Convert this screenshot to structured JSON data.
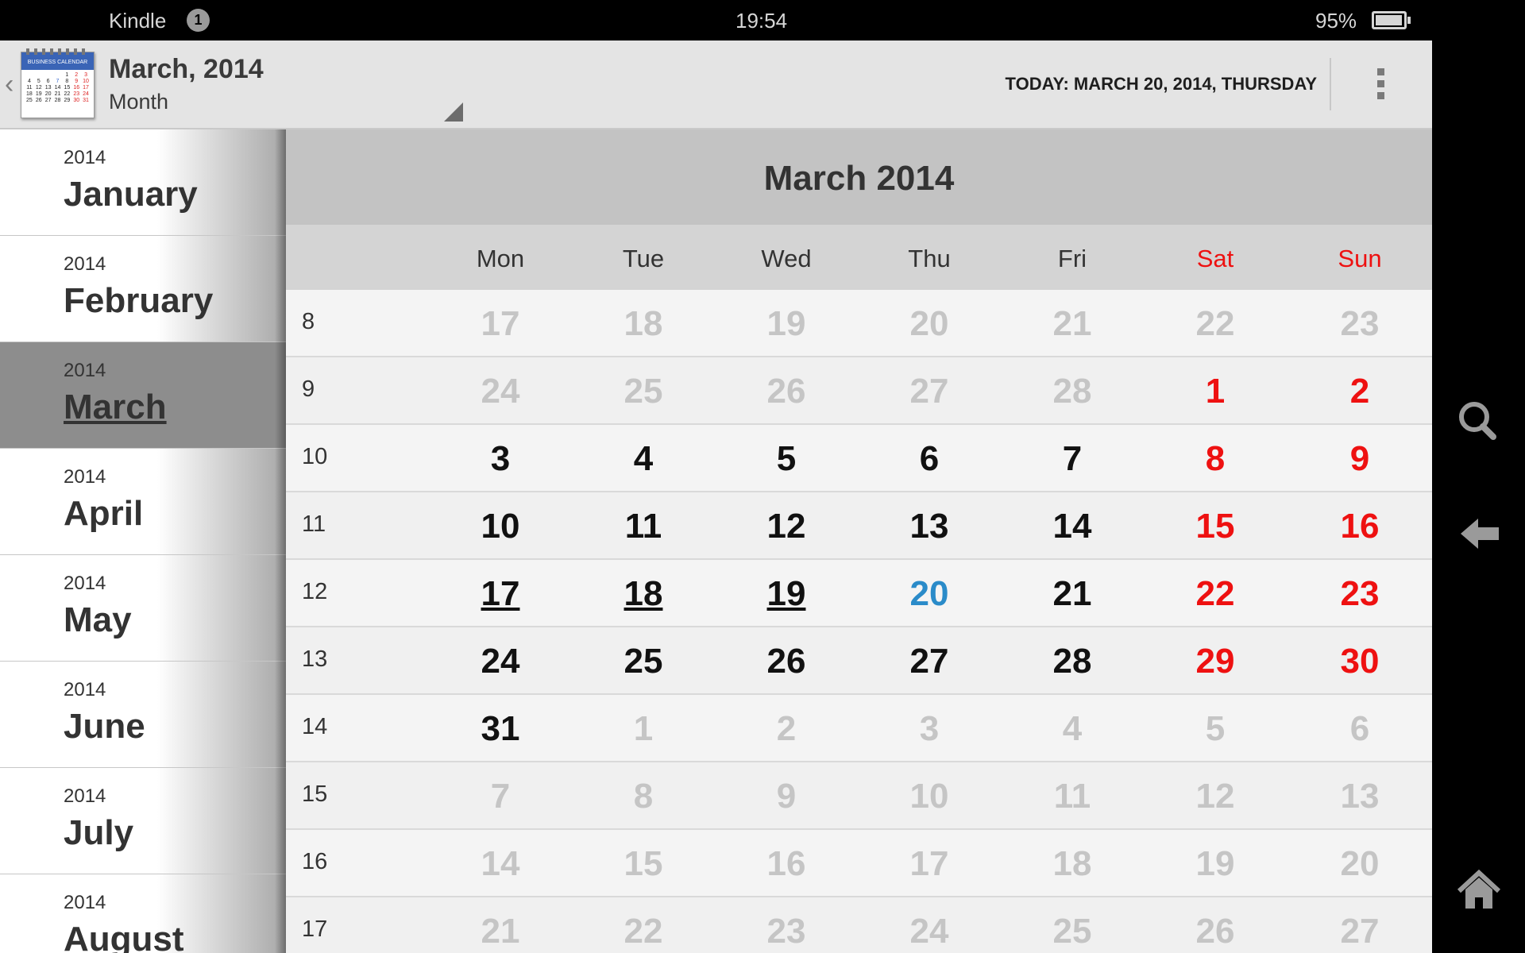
{
  "status_bar": {
    "app_name": "Kindle",
    "notification_count": "1",
    "time": "19:54",
    "battery": "95%"
  },
  "action_bar": {
    "title": "March, 2014",
    "view_mode": "Month",
    "today": "TODAY: MARCH 20, 2014, THURSDAY",
    "app_icon": "business-calendar-icon"
  },
  "sidebar": {
    "items": [
      {
        "year": "2014",
        "month": "January"
      },
      {
        "year": "2014",
        "month": "February"
      },
      {
        "year": "2014",
        "month": "March"
      },
      {
        "year": "2014",
        "month": "April"
      },
      {
        "year": "2014",
        "month": "May"
      },
      {
        "year": "2014",
        "month": "June"
      },
      {
        "year": "2014",
        "month": "July"
      },
      {
        "year": "2014",
        "month": "August"
      }
    ],
    "selected": "March"
  },
  "calendar": {
    "title": "March 2014",
    "weekdays": [
      "Mon",
      "Tue",
      "Wed",
      "Thu",
      "Fri",
      "Sat",
      "Sun"
    ],
    "weeks": [
      {
        "num": "8",
        "days": [
          {
            "d": "17",
            "t": "other"
          },
          {
            "d": "18",
            "t": "other"
          },
          {
            "d": "19",
            "t": "other"
          },
          {
            "d": "20",
            "t": "other"
          },
          {
            "d": "21",
            "t": "other"
          },
          {
            "d": "22",
            "t": "other"
          },
          {
            "d": "23",
            "t": "other"
          }
        ]
      },
      {
        "num": "9",
        "days": [
          {
            "d": "24",
            "t": "other"
          },
          {
            "d": "25",
            "t": "other"
          },
          {
            "d": "26",
            "t": "other"
          },
          {
            "d": "27",
            "t": "other"
          },
          {
            "d": "28",
            "t": "other"
          },
          {
            "d": "1",
            "t": "weekend"
          },
          {
            "d": "2",
            "t": "weekend"
          }
        ]
      },
      {
        "num": "10",
        "days": [
          {
            "d": "3",
            "t": "normal"
          },
          {
            "d": "4",
            "t": "normal"
          },
          {
            "d": "5",
            "t": "normal"
          },
          {
            "d": "6",
            "t": "normal"
          },
          {
            "d": "7",
            "t": "normal"
          },
          {
            "d": "8",
            "t": "weekend"
          },
          {
            "d": "9",
            "t": "weekend"
          }
        ]
      },
      {
        "num": "11",
        "days": [
          {
            "d": "10",
            "t": "normal"
          },
          {
            "d": "11",
            "t": "normal"
          },
          {
            "d": "12",
            "t": "normal"
          },
          {
            "d": "13",
            "t": "normal"
          },
          {
            "d": "14",
            "t": "normal"
          },
          {
            "d": "15",
            "t": "weekend"
          },
          {
            "d": "16",
            "t": "weekend"
          }
        ]
      },
      {
        "num": "12",
        "days": [
          {
            "d": "17",
            "t": "normal",
            "u": true
          },
          {
            "d": "18",
            "t": "normal",
            "u": true
          },
          {
            "d": "19",
            "t": "normal",
            "u": true
          },
          {
            "d": "20",
            "t": "today"
          },
          {
            "d": "21",
            "t": "normal"
          },
          {
            "d": "22",
            "t": "weekend"
          },
          {
            "d": "23",
            "t": "weekend"
          }
        ]
      },
      {
        "num": "13",
        "days": [
          {
            "d": "24",
            "t": "normal"
          },
          {
            "d": "25",
            "t": "normal"
          },
          {
            "d": "26",
            "t": "normal"
          },
          {
            "d": "27",
            "t": "normal"
          },
          {
            "d": "28",
            "t": "normal"
          },
          {
            "d": "29",
            "t": "weekend"
          },
          {
            "d": "30",
            "t": "weekend"
          }
        ]
      },
      {
        "num": "14",
        "days": [
          {
            "d": "31",
            "t": "normal"
          },
          {
            "d": "1",
            "t": "other"
          },
          {
            "d": "2",
            "t": "other"
          },
          {
            "d": "3",
            "t": "other"
          },
          {
            "d": "4",
            "t": "other"
          },
          {
            "d": "5",
            "t": "other"
          },
          {
            "d": "6",
            "t": "other"
          }
        ]
      },
      {
        "num": "15",
        "days": [
          {
            "d": "7",
            "t": "other"
          },
          {
            "d": "8",
            "t": "other"
          },
          {
            "d": "9",
            "t": "other"
          },
          {
            "d": "10",
            "t": "other"
          },
          {
            "d": "11",
            "t": "other"
          },
          {
            "d": "12",
            "t": "other"
          },
          {
            "d": "13",
            "t": "other"
          }
        ]
      },
      {
        "num": "16",
        "days": [
          {
            "d": "14",
            "t": "other"
          },
          {
            "d": "15",
            "t": "other"
          },
          {
            "d": "16",
            "t": "other"
          },
          {
            "d": "17",
            "t": "other"
          },
          {
            "d": "18",
            "t": "other"
          },
          {
            "d": "19",
            "t": "other"
          },
          {
            "d": "20",
            "t": "other"
          }
        ]
      },
      {
        "num": "17",
        "days": [
          {
            "d": "21",
            "t": "other"
          },
          {
            "d": "22",
            "t": "other"
          },
          {
            "d": "23",
            "t": "other"
          },
          {
            "d": "24",
            "t": "other"
          },
          {
            "d": "25",
            "t": "other"
          },
          {
            "d": "26",
            "t": "other"
          },
          {
            "d": "27",
            "t": "other"
          }
        ]
      }
    ]
  },
  "nav_bar": {
    "buttons": [
      "search-icon",
      "back-icon",
      "home-icon"
    ]
  },
  "colors": {
    "weekend": "#ee1111",
    "today": "#2a8bc9",
    "other_month": "#c5c5c5",
    "header_bg": "#c3c3c3"
  }
}
